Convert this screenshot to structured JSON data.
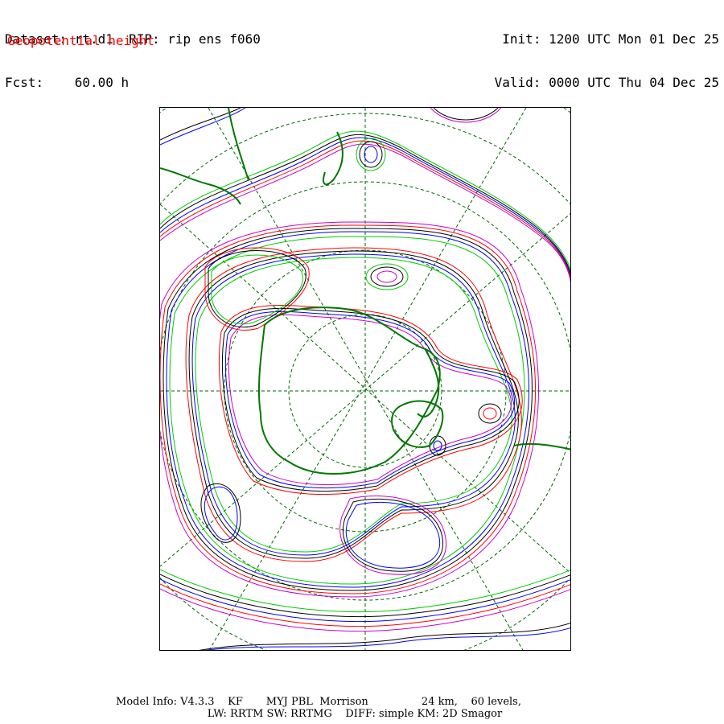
{
  "header": {
    "dataset_label": "Dataset: rt.d1  RIP: rip ens f060",
    "forecast_label": "Fcst:    60.00 h",
    "init_label": "Init: 1200 UTC Mon 01 Dec 25",
    "valid_label": "Valid: 0000 UTC Thu 04 Dec 25"
  },
  "field": {
    "name": "Geopotential height",
    "color": "#ff0000"
  },
  "map": {
    "projection": "polar stereographic",
    "contour_colors": [
      "#000000",
      "#0000ff",
      "#ff0000",
      "#00cc00",
      "#cc00cc"
    ],
    "coastline_color": "#007700",
    "gridline_color": "#006600"
  },
  "footer": {
    "model_info": "Model Info: V4.3.3    KF       MYJ PBL  Morrison                24 km,    60 levels,",
    "physics_info": "LW: RRTM SW: RRTMG    DIFF: simple KM: 2D Smagor"
  }
}
